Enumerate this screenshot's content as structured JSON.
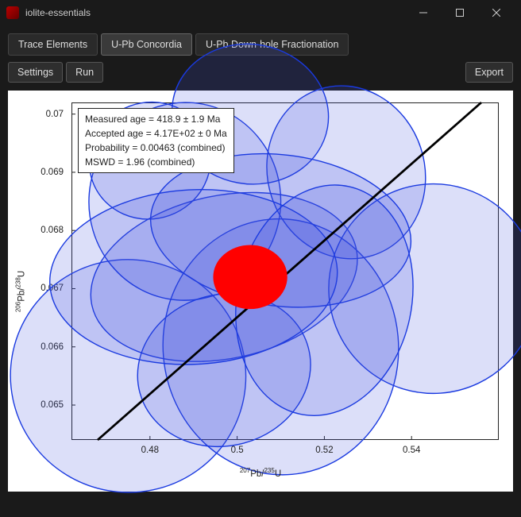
{
  "window": {
    "title": "iolite-essentials"
  },
  "tabs": [
    {
      "label": "Trace Elements",
      "active": false
    },
    {
      "label": "U-Pb Concordia",
      "active": true
    },
    {
      "label": "U-Pb Down-hole Fractionation",
      "active": false
    }
  ],
  "toolbar": {
    "settings_label": "Settings",
    "run_label": "Run",
    "export_label": "Export"
  },
  "info": {
    "line1": "Measured age = 418.9 ± 1.9 Ma",
    "line2": "Accepted age = 4.17E+02 ± 0 Ma",
    "line3": "Probability = 0.00463 (combined)",
    "line4": "MSWD = 1.96 (combined)"
  },
  "chart_data": {
    "type": "scatter",
    "title": "",
    "xlabel": "207Pb/235U",
    "ylabel": "206Pb/238U",
    "xlim": [
      0.462,
      0.56
    ],
    "ylim": [
      0.0644,
      0.0702
    ],
    "x_ticks": [
      0.48,
      0.5,
      0.52,
      0.54
    ],
    "y_ticks": [
      0.065,
      0.066,
      0.067,
      0.068,
      0.069,
      0.07
    ],
    "concordia_line": {
      "x1": 0.468,
      "y1": 0.0644,
      "x2": 0.556,
      "y2": 0.0702
    },
    "central_point": {
      "x": 0.503,
      "y": 0.0672,
      "rx": 0.0085,
      "ry": 0.00055,
      "color": "#ff0000"
    },
    "ellipses": [
      {
        "cx": 0.475,
        "cy": 0.0655,
        "rx": 0.027,
        "ry": 0.002,
        "rot": -10
      },
      {
        "cx": 0.497,
        "cy": 0.0672,
        "rx": 0.031,
        "ry": 0.0014,
        "rot": 12
      },
      {
        "cx": 0.51,
        "cy": 0.066,
        "rx": 0.027,
        "ry": 0.0022,
        "rot": 5
      },
      {
        "cx": 0.488,
        "cy": 0.0685,
        "rx": 0.022,
        "ry": 0.0017,
        "rot": -5
      },
      {
        "cx": 0.525,
        "cy": 0.069,
        "rx": 0.018,
        "ry": 0.0015,
        "rot": 18
      },
      {
        "cx": 0.545,
        "cy": 0.067,
        "rx": 0.024,
        "ry": 0.0018,
        "rot": 4
      },
      {
        "cx": 0.503,
        "cy": 0.07,
        "rx": 0.018,
        "ry": 0.0012,
        "rot": -10
      },
      {
        "cx": 0.48,
        "cy": 0.0692,
        "rx": 0.014,
        "ry": 0.001,
        "rot": 20
      },
      {
        "cx": 0.51,
        "cy": 0.068,
        "rx": 0.03,
        "ry": 0.0013,
        "rot": -7
      },
      {
        "cx": 0.497,
        "cy": 0.0656,
        "rx": 0.02,
        "ry": 0.0013,
        "rot": 15
      },
      {
        "cx": 0.49,
        "cy": 0.0672,
        "rx": 0.033,
        "ry": 0.0015,
        "rot": 3
      },
      {
        "cx": 0.52,
        "cy": 0.0668,
        "rx": 0.02,
        "ry": 0.002,
        "rot": -12
      }
    ],
    "ellipse_fill": "rgba(60,80,220,0.18)",
    "ellipse_stroke": "#1a3ae0"
  }
}
